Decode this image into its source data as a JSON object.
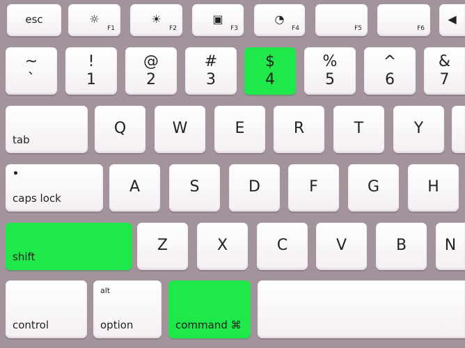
{
  "colors": {
    "highlight": "#1ee84a",
    "background": "#a2939c",
    "key": "#ffffff"
  },
  "highlighted_keys": [
    "4",
    "shift",
    "command"
  ],
  "fn_row": [
    {
      "main": "esc"
    },
    {
      "icon": "brightness-down-icon",
      "glyph": "☼",
      "sub": "F1"
    },
    {
      "icon": "brightness-up-icon",
      "glyph": "☀",
      "sub": "F2"
    },
    {
      "icon": "mission-control-icon",
      "glyph": "▣",
      "sub": "F3"
    },
    {
      "icon": "dashboard-icon",
      "glyph": "◔",
      "sub": "F4"
    },
    {
      "sub": "F5"
    },
    {
      "sub": "F6"
    },
    {
      "icon": "rewind-icon",
      "glyph": "◀"
    }
  ],
  "number_row": [
    {
      "top": "~",
      "bot": "`"
    },
    {
      "top": "!",
      "bot": "1"
    },
    {
      "top": "@",
      "bot": "2"
    },
    {
      "top": "#",
      "bot": "3"
    },
    {
      "top": "$",
      "bot": "4"
    },
    {
      "top": "%",
      "bot": "5"
    },
    {
      "top": "^",
      "bot": "6"
    },
    {
      "top": "&",
      "bot": "7"
    }
  ],
  "qwerty_row": {
    "tab": "tab",
    "keys": [
      "Q",
      "W",
      "E",
      "R",
      "T",
      "Y"
    ]
  },
  "home_row": {
    "caps": "caps lock",
    "keys": [
      "A",
      "S",
      "D",
      "F",
      "G",
      "H"
    ]
  },
  "bottom_letter_row": {
    "shift": "shift",
    "keys": [
      "Z",
      "X",
      "C",
      "V",
      "B",
      "N"
    ]
  },
  "modifier_row": {
    "control": "control",
    "option_top": "alt",
    "option": "option",
    "command": "command ⌘"
  }
}
